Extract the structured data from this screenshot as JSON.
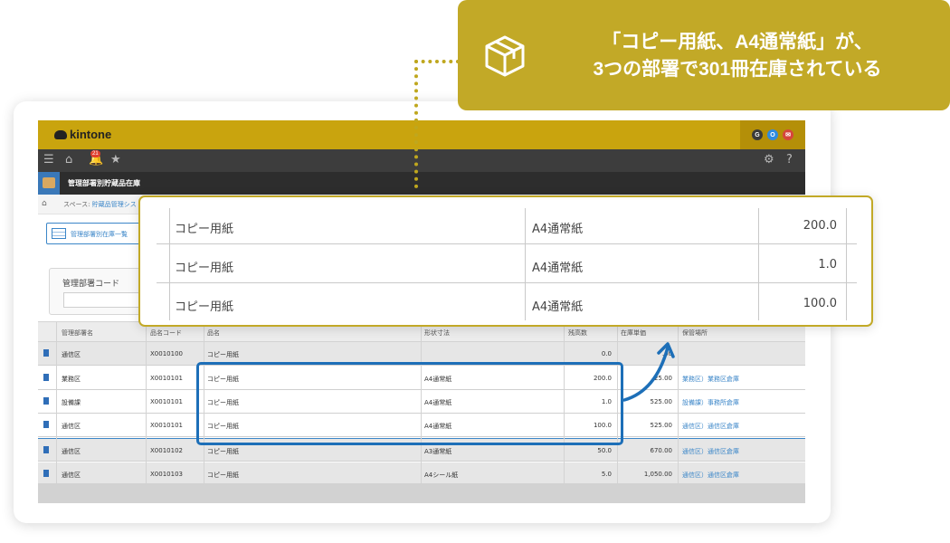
{
  "callout": {
    "line1": "「コピー用紙、A4通常紙」が、",
    "line2": "3つの部署で301冊在庫されている",
    "icon": "box-icon"
  },
  "app": {
    "logo": "kintone",
    "notification_count": "21",
    "title": "管理部署別貯蔵品在庫",
    "breadcrumb_prefix": "スペース: ",
    "breadcrumb_link": "貯蔵品管理シス",
    "view_label": "管理部署別在庫一覧",
    "filter_label": "管理部署コード",
    "header_buttons": [
      "G",
      "O",
      "✉"
    ]
  },
  "zoom": {
    "rows": [
      {
        "name": "コピー用紙",
        "size": "A4通常紙",
        "qty": "200.0"
      },
      {
        "name": "コピー用紙",
        "size": "A4通常紙",
        "qty": "1.0"
      },
      {
        "name": "コピー用紙",
        "size": "A4通常紙",
        "qty": "100.0"
      }
    ]
  },
  "table": {
    "headers": [
      "管理部署名",
      "品名コード",
      "品名",
      "形状寸法",
      "残高数",
      "在庫単価",
      "保管場所"
    ],
    "rows": [
      {
        "dept": "通信区",
        "code": "X0010100",
        "name": "コピー用紙",
        "size": "",
        "qty": "0.0",
        "price": ".00",
        "place": ""
      },
      {
        "dept": "業務区",
        "code": "X0010101",
        "name": "コピー用紙",
        "size": "A4通常紙",
        "qty": "200.0",
        "price": "25.00",
        "place": "業務区）業務区倉庫"
      },
      {
        "dept": "設備課",
        "code": "X0010101",
        "name": "コピー用紙",
        "size": "A4通常紙",
        "qty": "1.0",
        "price": "525.00",
        "place": "設備課）事務所倉庫"
      },
      {
        "dept": "通信区",
        "code": "X0010101",
        "name": "コピー用紙",
        "size": "A4通常紙",
        "qty": "100.0",
        "price": "525.00",
        "place": "通信区）通信区倉庫"
      },
      {
        "dept": "通信区",
        "code": "X0010102",
        "name": "コピー用紙",
        "size": "A3通常紙",
        "qty": "50.0",
        "price": "670.00",
        "place": "通信区）通信区倉庫"
      },
      {
        "dept": "通信区",
        "code": "X0010103",
        "name": "コピー用紙",
        "size": "A4シール紙",
        "qty": "5.0",
        "price": "1,050.00",
        "place": "通信区）通信区倉庫"
      }
    ]
  }
}
